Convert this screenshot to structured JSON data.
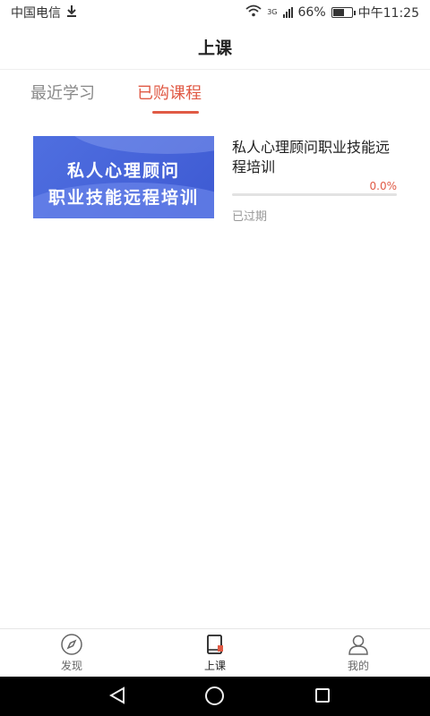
{
  "status_bar": {
    "carrier": "中国电信",
    "network": "3G",
    "battery": "66%",
    "battery_level": 0.66,
    "time": "中午11:25"
  },
  "header": {
    "title": "上课"
  },
  "tabs": [
    {
      "label": "最近学习",
      "active": false
    },
    {
      "label": "已购课程",
      "active": true
    }
  ],
  "course": {
    "thumbnail_line1": "私人心理顾问",
    "thumbnail_line2": "职业技能远程培训",
    "title": "私人心理顾问职业技能远程培训",
    "progress_label": "0.0%",
    "progress": 0.0,
    "status": "已过期"
  },
  "bottom_nav": [
    {
      "label": "发现",
      "icon": "compass-icon",
      "active": false
    },
    {
      "label": "上课",
      "icon": "book-icon",
      "active": true
    },
    {
      "label": "我的",
      "icon": "user-icon",
      "active": false
    }
  ],
  "colors": {
    "accent": "#e05a45",
    "thumbnail": "#4562d8"
  }
}
